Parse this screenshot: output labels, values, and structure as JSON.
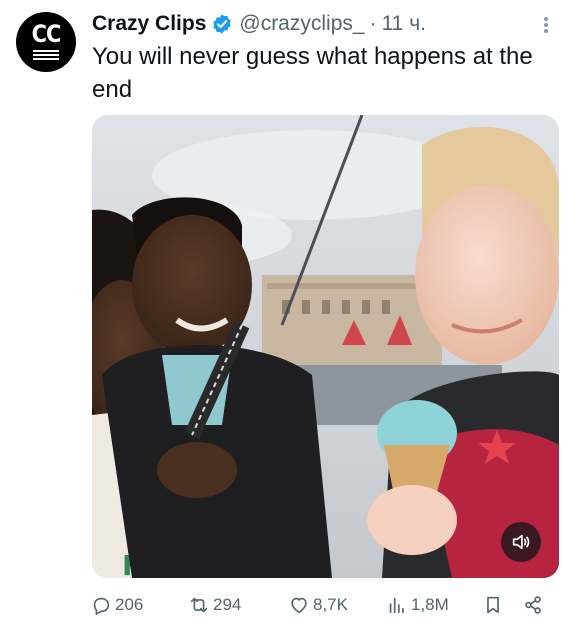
{
  "author": {
    "avatar_text": "CC",
    "name": "Crazy Clips",
    "handle": "@crazyclips_",
    "separator": "·",
    "time": "11 ч."
  },
  "tweet": {
    "text": "You will never guess what happens at the end"
  },
  "media": {
    "type": "video",
    "sound_icon": "speaker-icon"
  },
  "actions": {
    "replies": "206",
    "reposts": "294",
    "likes": "8,7K",
    "views": "1,8M"
  },
  "colors": {
    "text": "#0f1419",
    "secondary": "#536471",
    "verified": "#1d9bf0"
  }
}
